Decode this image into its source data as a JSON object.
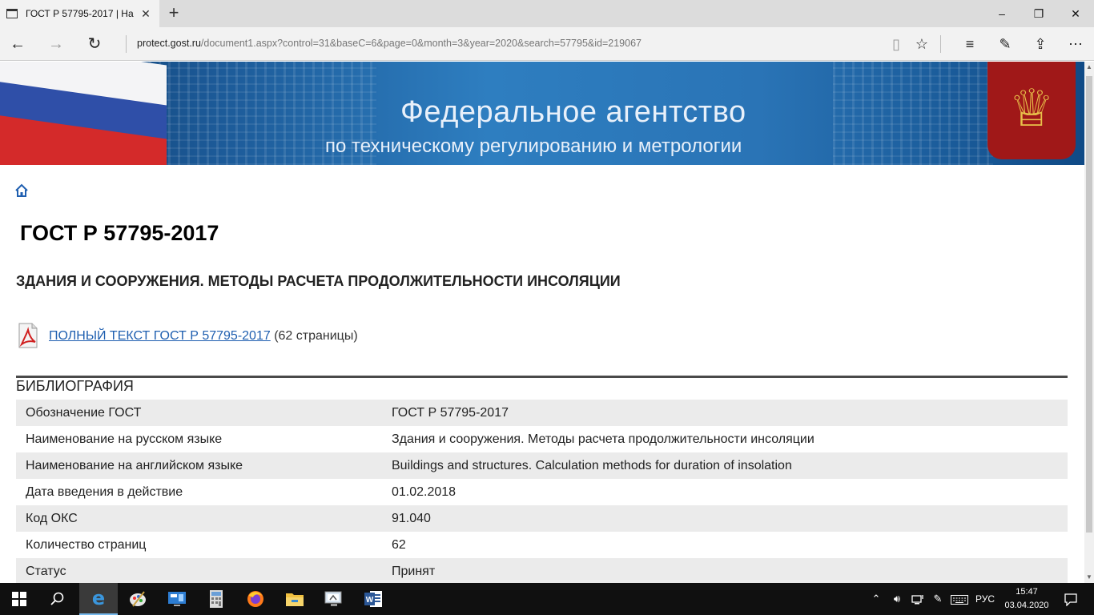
{
  "browser": {
    "tab_title": "ГОСТ Р 57795-2017 | На",
    "tab_close": "✕",
    "new_tab": "+",
    "url_host": "protect.gost.ru",
    "url_rest": "/document1.aspx?control=31&baseC=6&page=0&month=3&year=2020&search=57795&id=219067"
  },
  "banner": {
    "title": "Федеральное агентство",
    "subtitle": "по техническому регулированию и метрологии"
  },
  "document": {
    "title": "ГОСТ Р 57795-2017",
    "subtitle": "ЗДАНИЯ И СООРУЖЕНИЯ. МЕТОДЫ РАСЧЕТА ПРОДОЛЖИТЕЛЬНОСТИ ИНСОЛЯЦИИ",
    "full_text_link": "ПОЛНЫЙ ТЕКСТ ГОСТ Р 57795-2017",
    "pages_note": "(62 страницы)"
  },
  "bibliography": {
    "heading": "БИБЛИОГРАФИЯ",
    "rows": [
      {
        "key": "Обозначение ГОСТ",
        "value": "ГОСТ Р 57795-2017"
      },
      {
        "key": "Наименование на русском языке",
        "value": "Здания и сооружения. Методы расчета продолжительности инсоляции"
      },
      {
        "key": "Наименование на английском языке",
        "value": "Buildings and structures. Calculation methods for duration of insolation"
      },
      {
        "key": "Дата введения в действие",
        "value": "01.02.2018"
      },
      {
        "key": "Код ОКС",
        "value": "91.040"
      },
      {
        "key": "Количество страниц",
        "value": "62"
      },
      {
        "key": "Статус",
        "value": "Принят"
      }
    ]
  },
  "taskbar": {
    "language": "РУС",
    "time": "15:47",
    "date": "03.04.2020"
  },
  "colors": {
    "link": "#1f5fb0",
    "row_stripe": "#ebebeb",
    "taskbar": "#101010"
  }
}
